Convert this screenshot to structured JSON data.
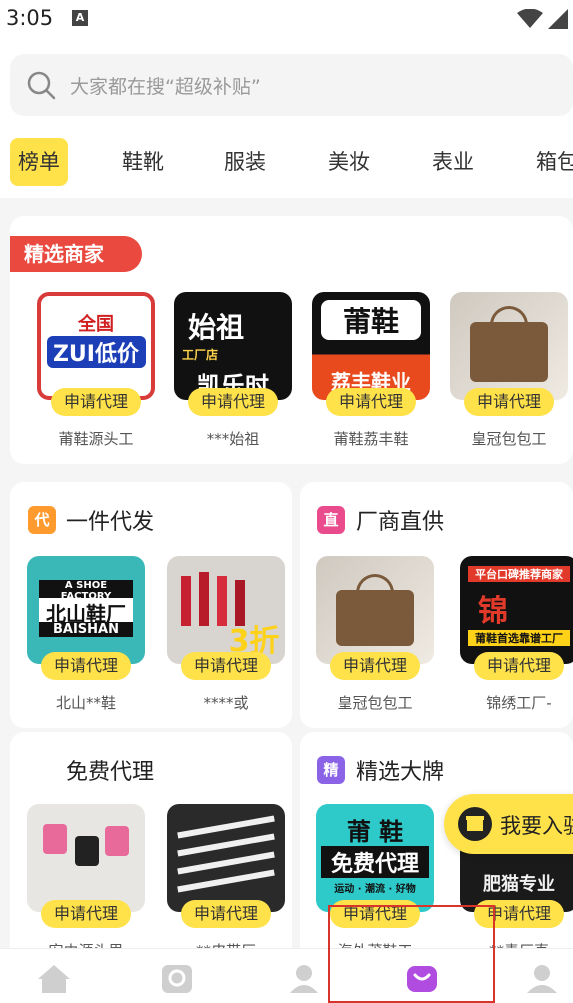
{
  "status": {
    "time": "3:05",
    "a_label": "A"
  },
  "search": {
    "placeholder": "大家都在搜“超级补贴”"
  },
  "categories": [
    "榜单",
    "鞋靴",
    "服装",
    "美妆",
    "表业",
    "箱包"
  ],
  "featured": {
    "badge": "精选商家",
    "stores": [
      {
        "name": "莆鞋源头工",
        "apply": "申请代理",
        "thumb": {
          "line1": "全国",
          "line2": "ZUI低价"
        }
      },
      {
        "name": "***始祖",
        "apply": "申请代理",
        "thumb": {
          "line1": "始祖",
          "line2": "工厂店",
          "line3": "凯乐时"
        }
      },
      {
        "name": "莆鞋荔丰鞋",
        "apply": "申请代理",
        "thumb": {
          "line1": "莆鞋",
          "line2": "荔丰鞋业"
        }
      },
      {
        "name": "皇冠包包工",
        "apply": "申请代理",
        "thumb": {}
      }
    ]
  },
  "sections": [
    {
      "icon_text": "代",
      "title": "一件代发",
      "color": "#ff9a2e",
      "items": [
        {
          "name": "北山**鞋",
          "apply": "申请代理",
          "thumb": {
            "line1": "A SHOE FACTORY",
            "line2": "北山鞋厂",
            "line3": "BAISHAN"
          }
        },
        {
          "name": "****或",
          "apply": "申请代理",
          "thumb": {
            "line1": "3折"
          }
        }
      ]
    },
    {
      "icon_text": "直",
      "title": "厂商直供",
      "color": "#e94b8c",
      "items": [
        {
          "name": "皇冠包包工",
          "apply": "申请代理",
          "thumb": {}
        },
        {
          "name": "锦绣工厂-",
          "apply": "申请代理",
          "thumb": {
            "line1": "平台口碑推荐商家",
            "line2": "锦",
            "line3": "莆鞋首选靠谱工厂"
          }
        }
      ]
    },
    {
      "icon_text": "",
      "title": "免费代理",
      "color": "#ffffff",
      "items": [
        {
          "name": "宏由源头思",
          "apply": "申请代理",
          "thumb": {}
        },
        {
          "name": "**皮带厂",
          "apply": "申请代理",
          "thumb": {}
        }
      ]
    },
    {
      "icon_text": "精",
      "title": "精选大牌",
      "color": "#8a63e6",
      "items": [
        {
          "name": "海外莆鞋工",
          "apply": "申请代理",
          "thumb": {
            "line1": "莆 鞋",
            "line2": "免费代理",
            "line3": "运动 · 潮流 · 好物"
          }
        },
        {
          "name": "**青厂直",
          "apply": "申请代理",
          "thumb": {
            "line1": "肥猫专业"
          }
        }
      ]
    }
  ],
  "float_button": {
    "label": "我要入驻"
  },
  "tabs": [
    "home-icon",
    "shop-icon",
    "agent-icon",
    "bag-icon",
    "profile-icon"
  ]
}
